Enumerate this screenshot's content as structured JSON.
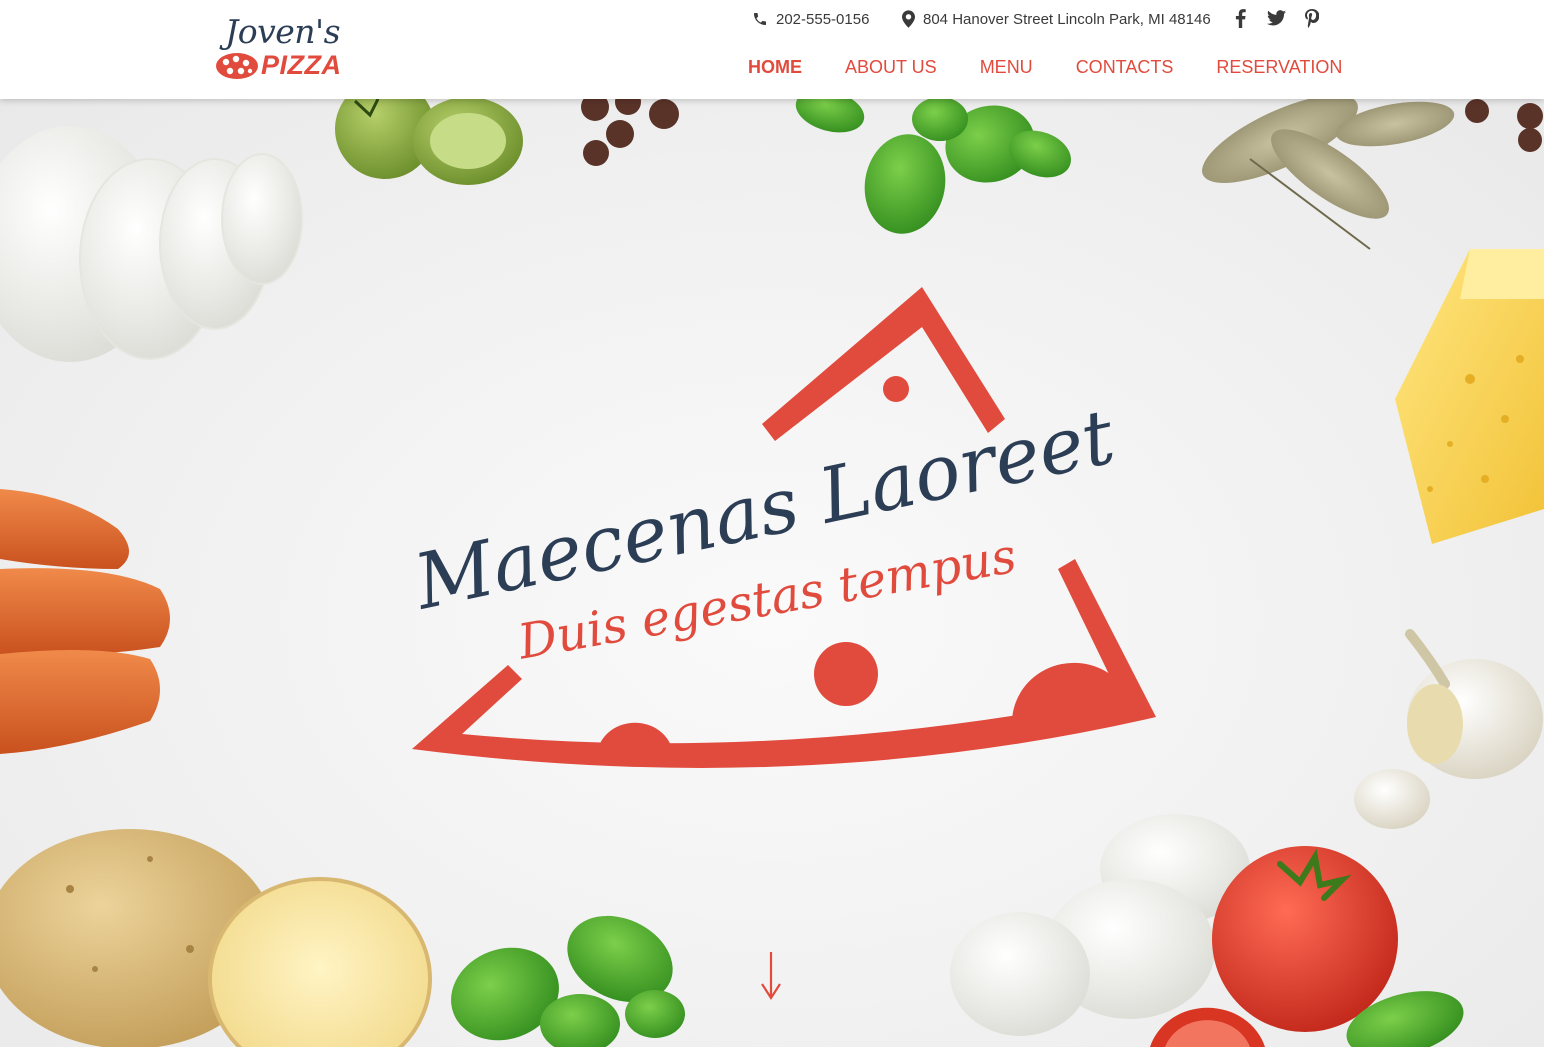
{
  "brand": {
    "script_name": "Joven's",
    "word": "PIZZA",
    "accent_color": "#e14b3d",
    "dark_color": "#2c3e55"
  },
  "header": {
    "phone": {
      "icon": "phone-icon",
      "text": "202-555-0156"
    },
    "address": {
      "icon": "map-pin-icon",
      "text": "804 Hanover Street Lincoln Park, MI 48146"
    },
    "social": [
      {
        "icon": "facebook-icon"
      },
      {
        "icon": "twitter-icon"
      },
      {
        "icon": "pinterest-icon"
      }
    ],
    "nav": [
      {
        "label": "HOME",
        "active": true
      },
      {
        "label": "ABOUT US",
        "active": false
      },
      {
        "label": "MENU",
        "active": false
      },
      {
        "label": "CONTACTS",
        "active": false
      },
      {
        "label": "RESERVATION",
        "active": false
      }
    ]
  },
  "hero": {
    "title": "Maecenas Laoreet",
    "subtitle": "Duis egestas tempus",
    "scroll_icon": "arrow-down-icon",
    "ingredients": [
      "mozzarella",
      "tomatoes",
      "peppercorns",
      "basil",
      "bay leaves",
      "cheese",
      "carrots",
      "garlic",
      "potatoes",
      "tomato"
    ]
  }
}
